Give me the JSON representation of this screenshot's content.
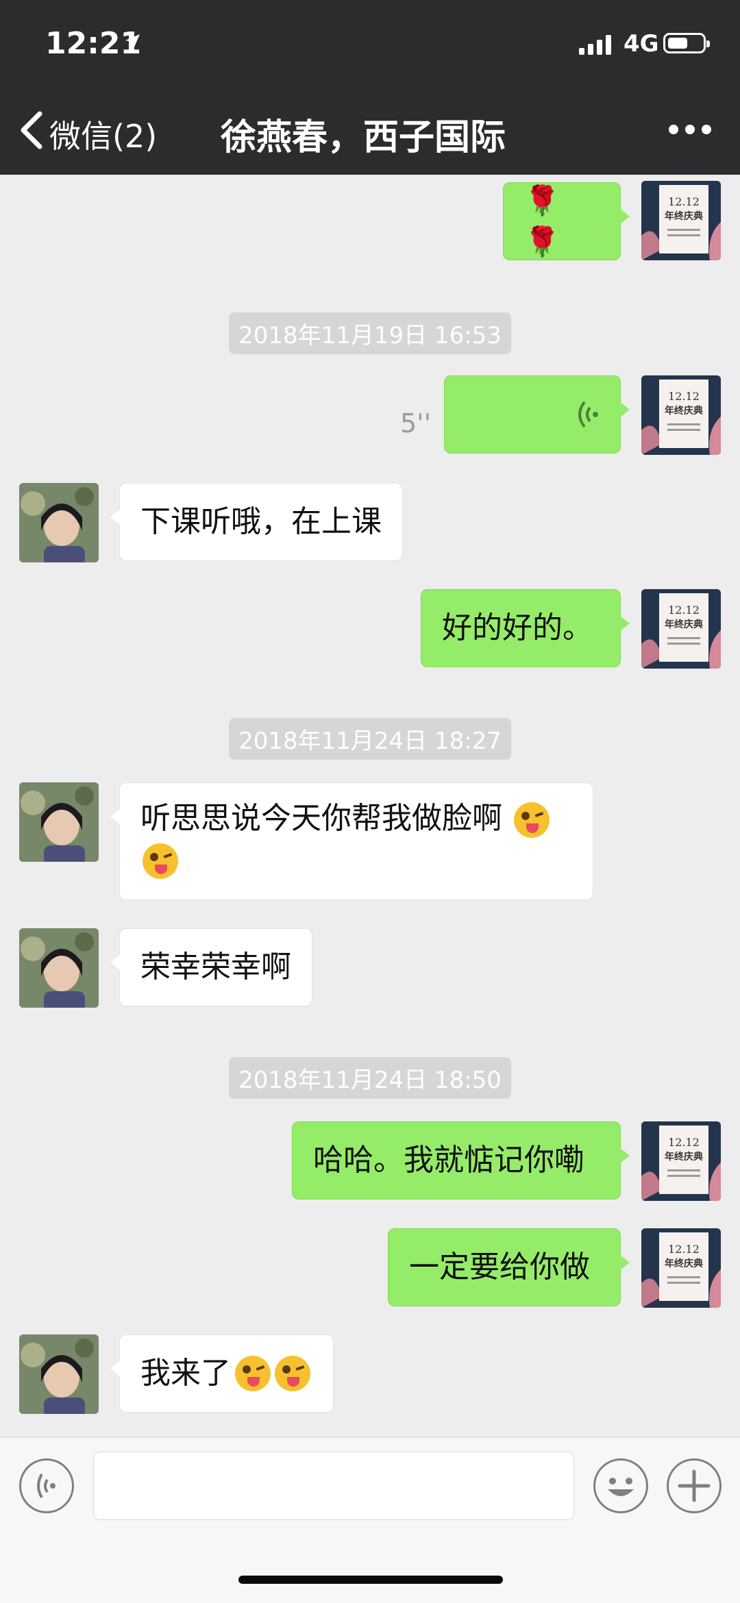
{
  "status_bar": {
    "time": "12:21",
    "network": "4G"
  },
  "nav": {
    "back_label": "微信(2)",
    "title": "徐燕春，西子国际"
  },
  "messages": {
    "m1": {
      "content": "🌹🌹"
    },
    "ts1": {
      "text": "2018年11月19日 16:53"
    },
    "m2": {
      "duration": "5''"
    },
    "m3": {
      "text": "下课听哦，在上课"
    },
    "m4": {
      "text": "好的好的。"
    },
    "ts2": {
      "text": "2018年11月24日 18:27"
    },
    "m5": {
      "text": "听思思说今天你帮我做脸啊"
    },
    "m6": {
      "text": "荣幸荣幸啊"
    },
    "ts3": {
      "text": "2018年11月24日 18:50"
    },
    "m7": {
      "text": "哈哈。我就惦记你嘞"
    },
    "m8": {
      "text": "一定要给你做"
    },
    "m9": {
      "text": "我来了"
    }
  },
  "avatar_me": {
    "line1": "12.12",
    "line2": "年终庆典"
  },
  "colors": {
    "header": "#2c2c2e",
    "outgoing_bubble": "#95ec69",
    "incoming_bubble": "#ffffff",
    "background": "#ededed"
  },
  "icons": [
    "chevron-left-icon",
    "more-icon",
    "voice-wave-icon",
    "rose-icon",
    "wink-tongue-emoji",
    "voice-mode-icon",
    "emoji-icon",
    "plus-icon"
  ]
}
